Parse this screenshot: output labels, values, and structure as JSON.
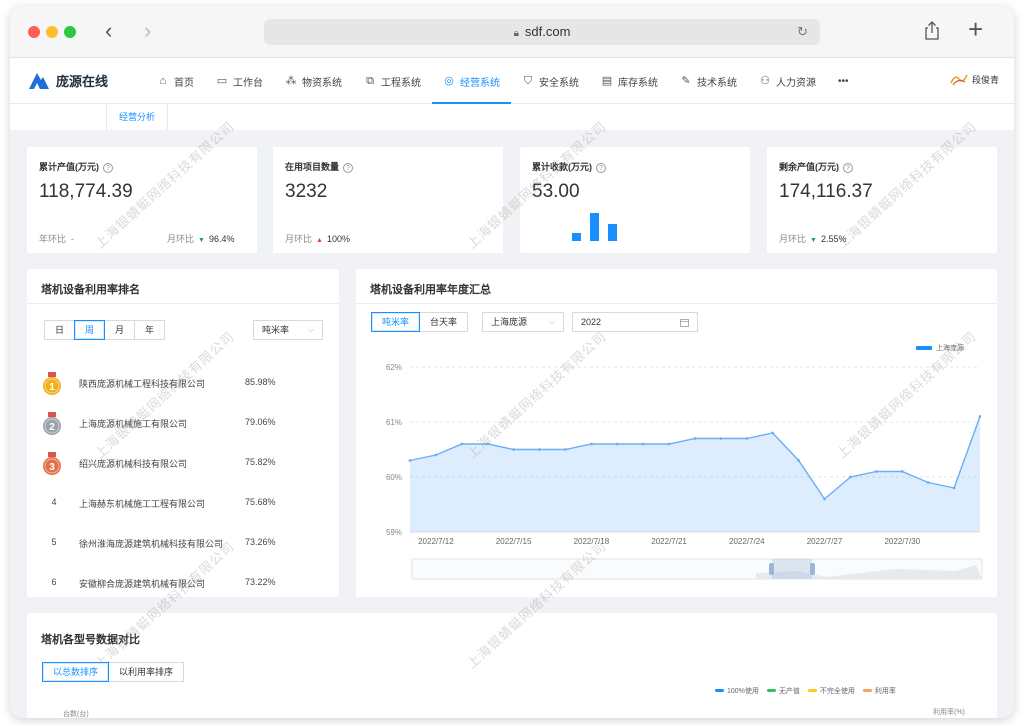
{
  "browser": {
    "url": "sdf.com"
  },
  "app": {
    "logo_text": "庞源在线",
    "menu": [
      {
        "label": "首页",
        "icon": "home-icon",
        "glyph": "⌂"
      },
      {
        "label": "工作台",
        "icon": "monitor-icon",
        "glyph": "▭"
      },
      {
        "label": "物资系统",
        "icon": "boxes-icon",
        "glyph": "⁂"
      },
      {
        "label": "工程系统",
        "icon": "copy-icon",
        "glyph": "⧉"
      },
      {
        "label": "经营系统",
        "icon": "target-icon",
        "glyph": "◎",
        "active": true
      },
      {
        "label": "安全系统",
        "icon": "shield-icon",
        "glyph": "⛉"
      },
      {
        "label": "库存系统",
        "icon": "file-icon",
        "glyph": "▤"
      },
      {
        "label": "技术系统",
        "icon": "edit-icon",
        "glyph": "✎"
      },
      {
        "label": "人力资源",
        "icon": "people-icon",
        "glyph": "⚇"
      },
      {
        "label": "•••",
        "icon": "more-icon",
        "glyph": ""
      }
    ],
    "user_name": "段俊青",
    "subtab": "经营分析",
    "accent": "#1890ff"
  },
  "kpis": [
    {
      "title": "累计产值(万元)",
      "value": "118,774.39",
      "left_label": "年环比",
      "left_value": "-",
      "right_label": "月环比",
      "trend": "down",
      "right_value": "96.4%"
    },
    {
      "title": "在用项目数量",
      "value": "3232",
      "left_label": "月环比",
      "trend": "up",
      "right_value": "100%"
    },
    {
      "title": "累计收款(万元)",
      "value": "53.00",
      "mini_bars": [
        0.3,
        1.0,
        0.62
      ]
    },
    {
      "title": "剩余产值(万元)",
      "value": "174,116.37",
      "left_label": "月环比",
      "trend": "down",
      "right_value": "2.55%"
    }
  ],
  "ranking": {
    "title": "塔机设备利用率排名",
    "periods": [
      "日",
      "周",
      "月",
      "年"
    ],
    "active_period": "周",
    "select": "吨米率",
    "rows": [
      {
        "rank": "1",
        "name": "陕西庞源机械工程科技有限公司",
        "value": "85.98%"
      },
      {
        "rank": "2",
        "name": "上海庞源机械施工有限公司",
        "value": "79.06%"
      },
      {
        "rank": "3",
        "name": "绍兴庞源机械科技有限公司",
        "value": "75.82%"
      },
      {
        "rank": "4",
        "name": "上海赫东机械施工工程有限公司",
        "value": "75.68%"
      },
      {
        "rank": "5",
        "name": "徐州淮海庞源建筑机械科技有限公司",
        "value": "73.26%"
      },
      {
        "rank": "6",
        "name": "安徽柳合庞源建筑机械有限公司",
        "value": "73.22%"
      }
    ]
  },
  "annual": {
    "title": "塔机设备利用率年度汇总",
    "tabs": [
      "吨米率",
      "台天率"
    ],
    "active_tab": "吨米率",
    "company_select": "上海庞源",
    "year": "2022"
  },
  "chart_data": {
    "type": "area",
    "series": [
      {
        "name": "上海庞源",
        "values": [
          60.3,
          60.4,
          60.6,
          60.6,
          60.5,
          60.5,
          60.5,
          60.6,
          60.6,
          60.6,
          60.6,
          60.7,
          60.7,
          60.7,
          60.8,
          60.3,
          59.6,
          60.0,
          60.1,
          60.1,
          59.9,
          59.8,
          61.1
        ]
      }
    ],
    "x_ticks": [
      "2022/7/12",
      "2022/7/15",
      "2022/7/18",
      "2022/7/21",
      "2022/7/24",
      "2022/7/27",
      "2022/7/30"
    ],
    "y_ticks": [
      "62%",
      "61%",
      "60%",
      "59%"
    ],
    "ylim": [
      59,
      62
    ],
    "color": "#6aaef5"
  },
  "compare": {
    "title": "塔机各型号数据对比",
    "tabs": [
      "以总数排序",
      "以利用率排序"
    ],
    "active_tab": "以总数排序",
    "legend": [
      {
        "label": "100%使用",
        "color": "#1890ff"
      },
      {
        "label": "无产值",
        "color": "#2fc25b"
      },
      {
        "label": "不完全使用",
        "color": "#facc14"
      },
      {
        "label": "利用率",
        "color": "#f7a35c"
      }
    ],
    "y_left_label": "台数(台)",
    "y_right_label": "利用率(%)"
  },
  "watermark_text": "上海银蜻蜓网络科技有限公司"
}
